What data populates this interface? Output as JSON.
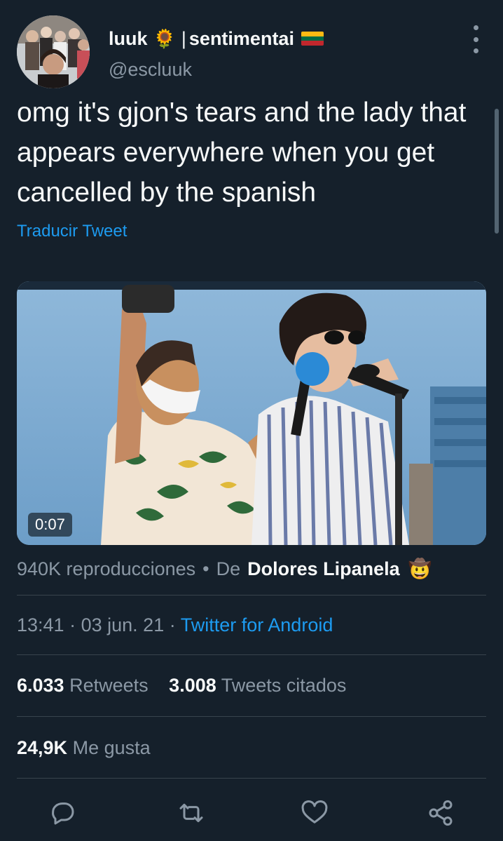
{
  "author": {
    "display_name": "luuk",
    "name_emoji": "🌻",
    "separator": "|",
    "name_suffix": "sentimentai",
    "suffix_emoji": "🇱🇹",
    "handle": "@escluuk"
  },
  "tweet": {
    "text": "omg it's gjon's tears and the lady that appears everywhere when you get cancelled by the spanish",
    "translate_label": "Traducir Tweet"
  },
  "media": {
    "duration": "0:07"
  },
  "views": {
    "count_label": "940K reproducciones",
    "dot": "•",
    "from_label": "De",
    "from_name": "Dolores Lipanela",
    "from_emoji": "🤠"
  },
  "meta": {
    "time": "13:41",
    "sep1": "·",
    "date": "03 jun. 21",
    "sep2": "·",
    "source": "Twitter for Android"
  },
  "stats": {
    "retweets_count": "6.033",
    "retweets_label": "Retweets",
    "quotes_count": "3.008",
    "quotes_label": "Tweets citados",
    "likes_count": "24,9K",
    "likes_label": "Me gusta"
  },
  "actions": [
    "reply-icon",
    "retweet-icon",
    "like-icon",
    "share-icon"
  ],
  "colors": {
    "background": "#15202b",
    "accent": "#1d9bf0",
    "secondary_text": "#8b98a5",
    "divider": "#38444d"
  }
}
